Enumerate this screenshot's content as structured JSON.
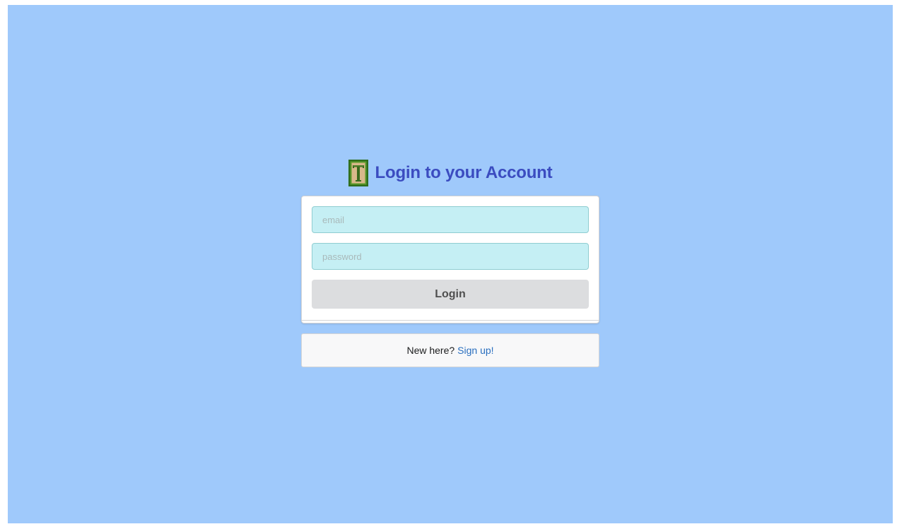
{
  "header": {
    "title": "Login to your Account",
    "logo_icon": "letter-t-logo-icon"
  },
  "form": {
    "email_placeholder": "email",
    "email_value": "",
    "password_placeholder": "password",
    "password_value": "",
    "login_label": "Login"
  },
  "signup": {
    "prompt": "New here?",
    "link_label": "Sign up!"
  },
  "colors": {
    "background": "#9fc9fb",
    "title": "#3b4cc0",
    "input_fill": "#c5eff4",
    "button_fill": "#dcdddf",
    "link": "#2a6fbf"
  }
}
